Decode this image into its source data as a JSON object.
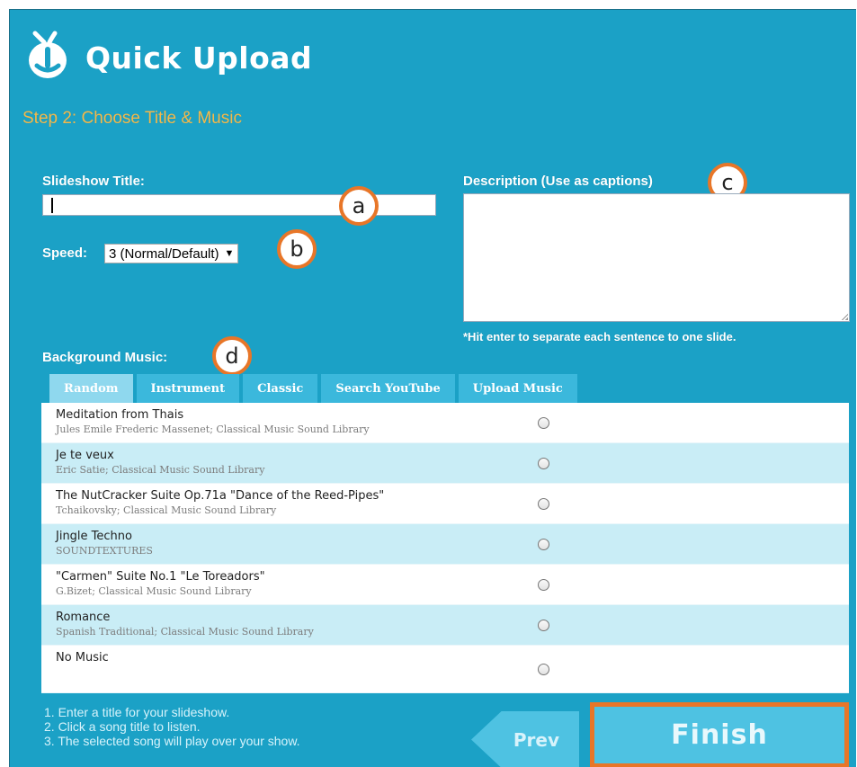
{
  "header": {
    "app_title": "Quick Upload",
    "logo_icon": "mouse-logo-icon"
  },
  "step_title": "Step 2: Choose Title & Music",
  "form": {
    "title_label": "Slideshow Title:",
    "title_value": "",
    "speed_label": "Speed:",
    "speed_value": "3 (Normal/Default)",
    "speed_arrow": "▼",
    "description_label": "Description (Use as captions)",
    "description_value": "",
    "description_hint": "*Hit enter to separate each sentence to one slide.",
    "music_label": "Background Music:"
  },
  "badges": {
    "a": "a",
    "b": "b",
    "c": "c",
    "d": "d"
  },
  "tabs": [
    {
      "label": "Random"
    },
    {
      "label": "Instrument"
    },
    {
      "label": "Classic"
    },
    {
      "label": "Search YouTube"
    },
    {
      "label": "Upload Music"
    }
  ],
  "songs": [
    {
      "title": "Meditation from Thais",
      "artist": "Jules Emile Frederic Massenet; Classical Music Sound Library"
    },
    {
      "title": "Je te veux",
      "artist": "Eric Satie; Classical Music Sound Library"
    },
    {
      "title": "The NutCracker Suite Op.71a \"Dance of the Reed-Pipes\"",
      "artist": "Tchaikovsky; Classical Music Sound Library"
    },
    {
      "title": "Jingle Techno",
      "artist": "SOUNDTEXTURES"
    },
    {
      "title": "\"Carmen\" Suite No.1 \"Le Toreadors\"",
      "artist": "G.Bizet; Classical Music Sound Library"
    },
    {
      "title": "Romance",
      "artist": "Spanish Traditional; Classical Music Sound Library"
    },
    {
      "title": "No Music",
      "artist": ""
    }
  ],
  "instructions": [
    "1. Enter a title for your slideshow.",
    "2. Click a song title to listen.",
    "3. The selected song will play over your show."
  ],
  "buttons": {
    "prev": "Prev",
    "finish": "Finish"
  },
  "colors": {
    "panel": "#1ba1c6",
    "accent_orange": "#e87628",
    "step_title": "#f4b94a",
    "active_tab": "#8fd8ee",
    "alt_row": "#c9edf6"
  }
}
